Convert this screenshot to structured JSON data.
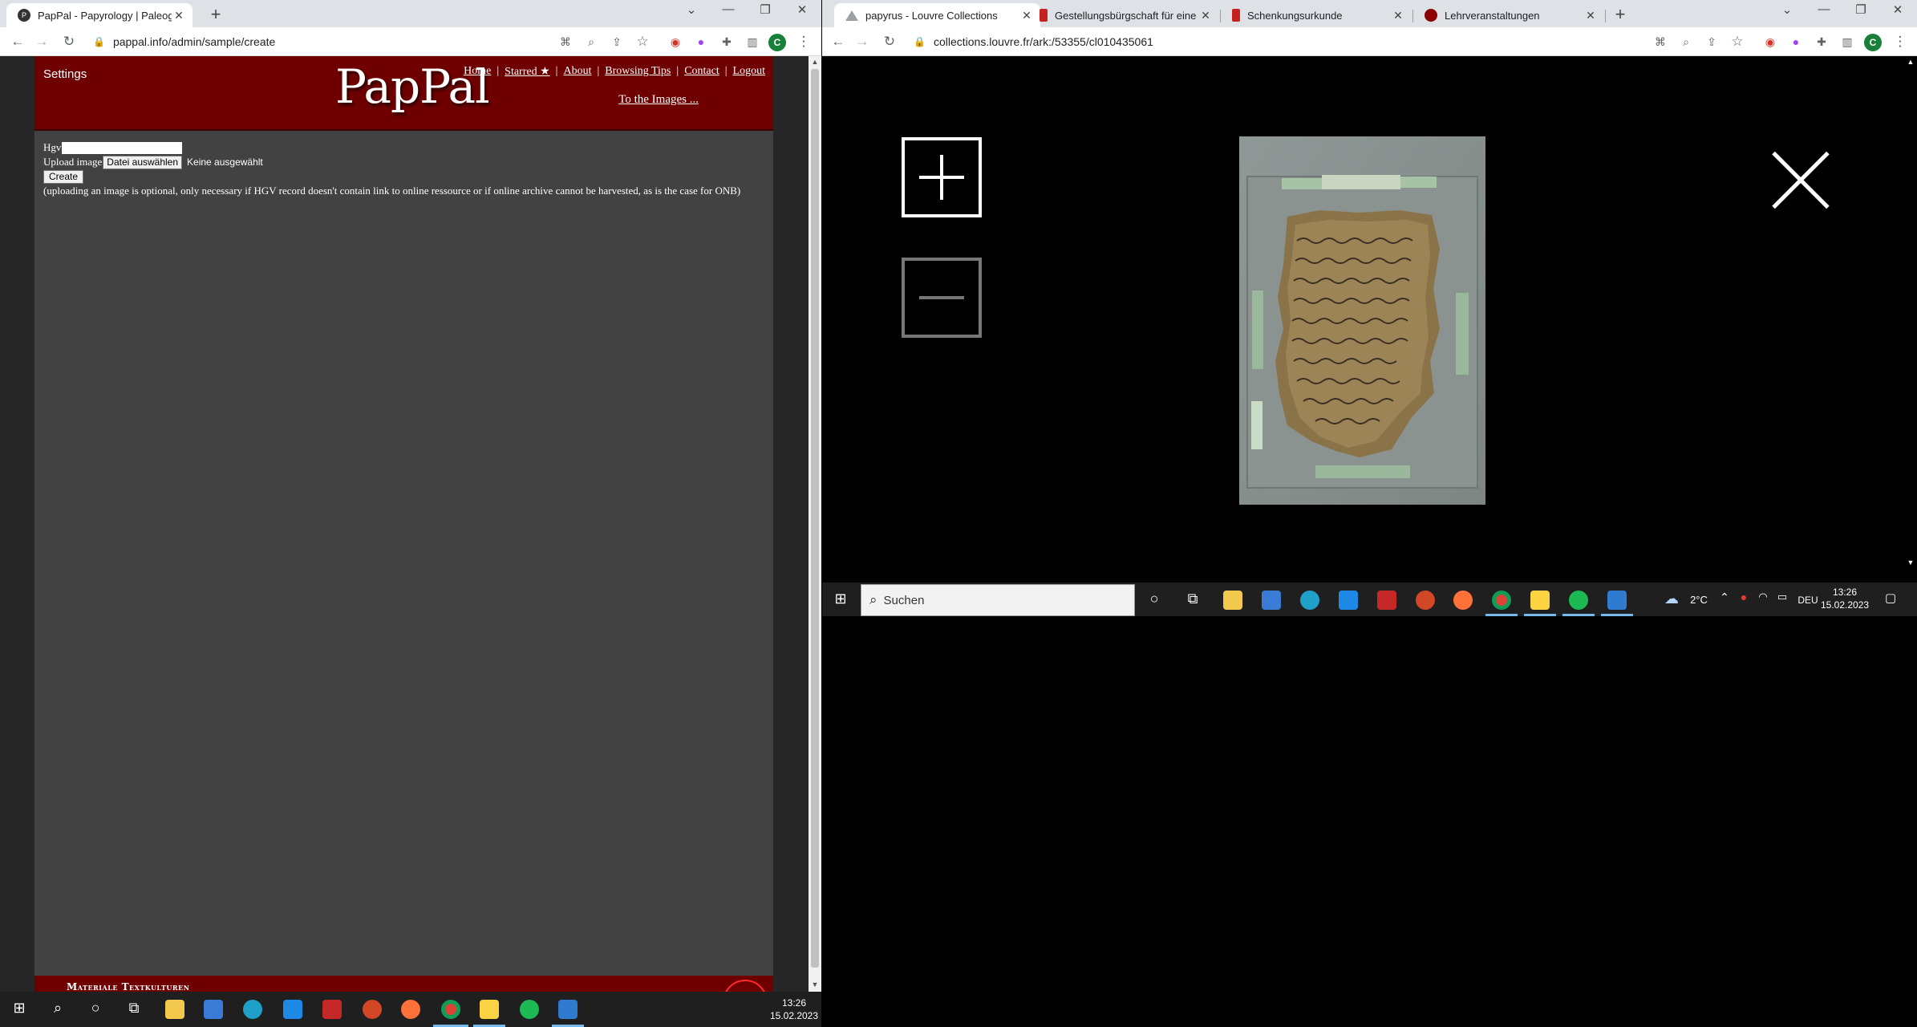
{
  "left_window": {
    "tab": {
      "title": "PapPal - Papyrology | Paleography",
      "favicon": "pappal-icon"
    },
    "address": "pappal.info/admin/sample/create",
    "profile_initial": "C",
    "page": {
      "settings_label": "Settings",
      "logo": "PapPal",
      "nav": [
        "Home",
        "Starred ★",
        "About",
        "Browsing Tips",
        "Contact",
        "Logout"
      ],
      "images_link": "To the Images ...",
      "form": {
        "hgv_label": "Hgv",
        "hgv_value": "",
        "upload_label": "Upload image",
        "file_button": "Datei auswählen",
        "file_status": "Keine ausgewählt",
        "create_button": "Create",
        "note": "(uploading an image is optional, only necessary if HGV record doesn't contain link to online ressource or if online archive cannot be harvested, as is the case for ONB)"
      },
      "footer_text": "Materiale Textkulturen"
    }
  },
  "right_window": {
    "tabs": [
      {
        "title": "papyrus - Louvre Collections",
        "active": true
      },
      {
        "title": "Gestellungsbürgschaft für eine N",
        "active": false
      },
      {
        "title": "Schenkungsurkunde",
        "active": false
      },
      {
        "title": "Lehrveranstaltungen",
        "active": false
      }
    ],
    "address": "collections.louvre.fr/ark:/53355/cl010435061",
    "profile_initial": "C",
    "viewer": {
      "zoom_in": "zoom-in-icon",
      "zoom_out": "zoom-out-icon",
      "close": "close-icon",
      "image": "papyrus fragment in glass frame"
    }
  },
  "taskbar_left": {
    "time": "13:26",
    "date": "15.02.2023"
  },
  "taskbar_right": {
    "search_placeholder": "Suchen",
    "weather": "2°C",
    "language": "DEU",
    "time": "13:26",
    "date": "15.02.2023"
  },
  "colors": {
    "pappal_header": "#6e0000",
    "pappal_body": "#424242",
    "taskbar": "#1f1f1f"
  }
}
